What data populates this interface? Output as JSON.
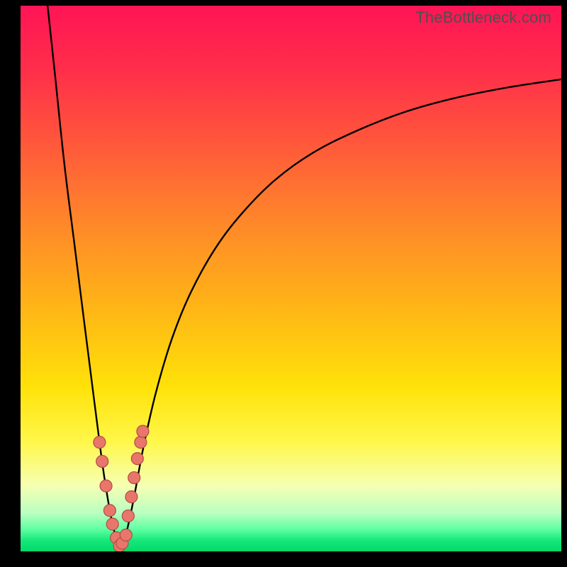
{
  "watermark": "TheBottleneck.com",
  "watermark_font_size_px": 22,
  "chart_data": {
    "type": "line",
    "title": "",
    "xlabel": "",
    "ylabel": "",
    "xlim": [
      0,
      100
    ],
    "ylim": [
      0,
      100
    ],
    "grid": false,
    "legend": false,
    "note": "Axis values estimated from pixel positions; x≈relative horizontal position (0–100), y≈bottleneck percentage (0 at bottom / 100 at top).",
    "series": [
      {
        "name": "left-branch",
        "x": [
          5.0,
          6.3,
          8.1,
          10.0,
          11.9,
          13.7,
          15.0,
          15.9,
          16.8,
          17.5,
          18.0
        ],
        "y": [
          100.0,
          88.0,
          71.0,
          56.0,
          41.0,
          27.0,
          17.0,
          11.0,
          6.0,
          3.0,
          1.5
        ]
      },
      {
        "name": "right-branch",
        "x": [
          18.7,
          19.7,
          21.0,
          22.7,
          25.0,
          28.0,
          31.5,
          36.0,
          41.0,
          47.0,
          54.0,
          62.0,
          71.0,
          80.0,
          90.0,
          100.0
        ],
        "y": [
          1.5,
          4.0,
          10.0,
          19.0,
          29.0,
          39.0,
          47.5,
          55.5,
          62.0,
          68.0,
          73.0,
          77.0,
          80.5,
          83.0,
          85.0,
          86.5
        ]
      }
    ],
    "optimum": {
      "x": 18.3,
      "y": 0.8
    },
    "marker_points": {
      "name": "pink-dots",
      "note": "Salmon-colored sample markers near the valley of the curve.",
      "x": [
        14.6,
        15.1,
        15.8,
        16.5,
        17.0,
        17.7,
        18.3,
        18.8,
        19.5,
        19.9,
        20.5,
        21.0,
        21.6,
        22.2,
        22.6
      ],
      "y": [
        20.0,
        16.5,
        12.0,
        7.5,
        5.0,
        2.5,
        1.0,
        1.5,
        3.0,
        6.5,
        10.0,
        13.5,
        17.0,
        20.0,
        22.0
      ]
    },
    "background_gradient": {
      "top_color": "#ff1455",
      "mid_color": "#ffe209",
      "bottom_color": "#06d96a",
      "direction": "vertical"
    }
  },
  "colors": {
    "frame": "#000000",
    "watermark": "#4f4f4f",
    "curve": "#000000",
    "dot_fill": "#e9766a",
    "dot_stroke": "#b04d44"
  }
}
